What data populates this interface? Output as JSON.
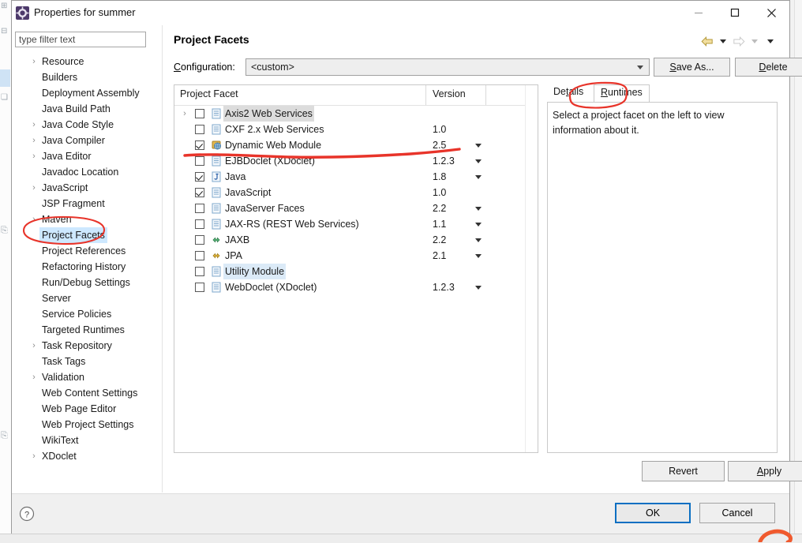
{
  "window": {
    "title": "Properties for summer",
    "icon": "eclipse-properties-icon",
    "minimize_label": "Minimize",
    "maximize_label": "Maximize",
    "close_label": "Close"
  },
  "sidebar": {
    "filter": {
      "placeholder": "type filter text",
      "value": ""
    },
    "items": [
      {
        "label": "Resource",
        "expandable": true,
        "selected": false
      },
      {
        "label": "Builders",
        "expandable": false,
        "selected": false
      },
      {
        "label": "Deployment Assembly",
        "expandable": false,
        "selected": false
      },
      {
        "label": "Java Build Path",
        "expandable": false,
        "selected": false
      },
      {
        "label": "Java Code Style",
        "expandable": true,
        "selected": false
      },
      {
        "label": "Java Compiler",
        "expandable": true,
        "selected": false
      },
      {
        "label": "Java Editor",
        "expandable": true,
        "selected": false
      },
      {
        "label": "Javadoc Location",
        "expandable": false,
        "selected": false
      },
      {
        "label": "JavaScript",
        "expandable": true,
        "selected": false
      },
      {
        "label": "JSP Fragment",
        "expandable": false,
        "selected": false
      },
      {
        "label": "Maven",
        "expandable": true,
        "selected": false
      },
      {
        "label": "Project Facets",
        "expandable": false,
        "selected": true
      },
      {
        "label": "Project References",
        "expandable": false,
        "selected": false
      },
      {
        "label": "Refactoring History",
        "expandable": false,
        "selected": false
      },
      {
        "label": "Run/Debug Settings",
        "expandable": false,
        "selected": false
      },
      {
        "label": "Server",
        "expandable": false,
        "selected": false
      },
      {
        "label": "Service Policies",
        "expandable": false,
        "selected": false
      },
      {
        "label": "Targeted Runtimes",
        "expandable": false,
        "selected": false
      },
      {
        "label": "Task Repository",
        "expandable": true,
        "selected": false
      },
      {
        "label": "Task Tags",
        "expandable": false,
        "selected": false
      },
      {
        "label": "Validation",
        "expandable": true,
        "selected": false
      },
      {
        "label": "Web Content Settings",
        "expandable": false,
        "selected": false
      },
      {
        "label": "Web Page Editor",
        "expandable": false,
        "selected": false
      },
      {
        "label": "Web Project Settings",
        "expandable": false,
        "selected": false
      },
      {
        "label": "WikiText",
        "expandable": false,
        "selected": false
      },
      {
        "label": "XDoclet",
        "expandable": true,
        "selected": false
      }
    ]
  },
  "page": {
    "title": "Project Facets",
    "nav": {
      "back_icon": "back-arrow-icon",
      "back_menu_icon": "chevron-down-icon",
      "forward_icon": "forward-arrow-icon",
      "forward_menu_icon": "chevron-down-icon",
      "view_menu_icon": "chevron-down-icon"
    },
    "configuration": {
      "label": "Configuration:",
      "label_mnemonic": "C",
      "value": "<custom>",
      "dropdown_icon": "chevron-down-icon"
    },
    "save_as_label": "Save As...",
    "save_as_mnemonic": "S",
    "delete_label": "Delete",
    "delete_mnemonic": "D"
  },
  "facets_table": {
    "columns": [
      "Project Facet",
      "Version"
    ],
    "rows": [
      {
        "name": "Axis2 Web Services",
        "version": "",
        "checked": false,
        "expandable": true,
        "has_version_menu": false,
        "icon": "document-icon",
        "highlight": "gray"
      },
      {
        "name": "CXF 2.x Web Services",
        "version": "1.0",
        "checked": false,
        "expandable": false,
        "has_version_menu": false,
        "icon": "document-icon",
        "highlight": "none"
      },
      {
        "name": "Dynamic Web Module",
        "version": "2.5",
        "checked": true,
        "expandable": false,
        "has_version_menu": true,
        "icon": "web-module-icon",
        "highlight": "none"
      },
      {
        "name": "EJBDoclet (XDoclet)",
        "version": "1.2.3",
        "checked": false,
        "expandable": false,
        "has_version_menu": true,
        "icon": "document-icon",
        "highlight": "none"
      },
      {
        "name": "Java",
        "version": "1.8",
        "checked": true,
        "expandable": false,
        "has_version_menu": true,
        "icon": "java-icon",
        "highlight": "none"
      },
      {
        "name": "JavaScript",
        "version": "1.0",
        "checked": true,
        "expandable": false,
        "has_version_menu": false,
        "icon": "document-icon",
        "highlight": "none"
      },
      {
        "name": "JavaServer Faces",
        "version": "2.2",
        "checked": false,
        "expandable": false,
        "has_version_menu": true,
        "icon": "document-icon",
        "highlight": "none"
      },
      {
        "name": "JAX-RS (REST Web Services)",
        "version": "1.1",
        "checked": false,
        "expandable": false,
        "has_version_menu": true,
        "icon": "document-icon",
        "highlight": "none"
      },
      {
        "name": "JAXB",
        "version": "2.2",
        "checked": false,
        "expandable": false,
        "has_version_menu": true,
        "icon": "jaxb-icon",
        "highlight": "none"
      },
      {
        "name": "JPA",
        "version": "2.1",
        "checked": false,
        "expandable": false,
        "has_version_menu": true,
        "icon": "jpa-icon",
        "highlight": "none"
      },
      {
        "name": "Utility Module",
        "version": "",
        "checked": false,
        "expandable": false,
        "has_version_menu": false,
        "icon": "document-icon",
        "highlight": "blue"
      },
      {
        "name": "WebDoclet (XDoclet)",
        "version": "1.2.3",
        "checked": false,
        "expandable": false,
        "has_version_menu": true,
        "icon": "document-icon",
        "highlight": "none"
      }
    ]
  },
  "detail_panel": {
    "tabs": [
      {
        "label": "Details",
        "mnemonic": "t",
        "active": false
      },
      {
        "label": "Runtimes",
        "mnemonic": "R",
        "active": true
      }
    ],
    "message": "Select a project facet on the left to view information about it."
  },
  "actions": {
    "revert_label": "Revert",
    "apply_label": "Apply",
    "apply_mnemonic": "A"
  },
  "footer": {
    "help_icon": "help-question-icon",
    "ok_label": "OK",
    "cancel_label": "Cancel"
  },
  "annotations": {
    "color": "#e8342a",
    "marks": [
      "ellipse-around-project-facets-sidebar-item",
      "ellipse-around-runtimes-tab",
      "underline-strike-through-facet-rows"
    ]
  },
  "colors": {
    "accent_blue": "#0a6fc2",
    "selection_blue": "#cde8ff",
    "row_highlight_gray": "#dcdcdc",
    "annotation_red": "#e8342a"
  }
}
